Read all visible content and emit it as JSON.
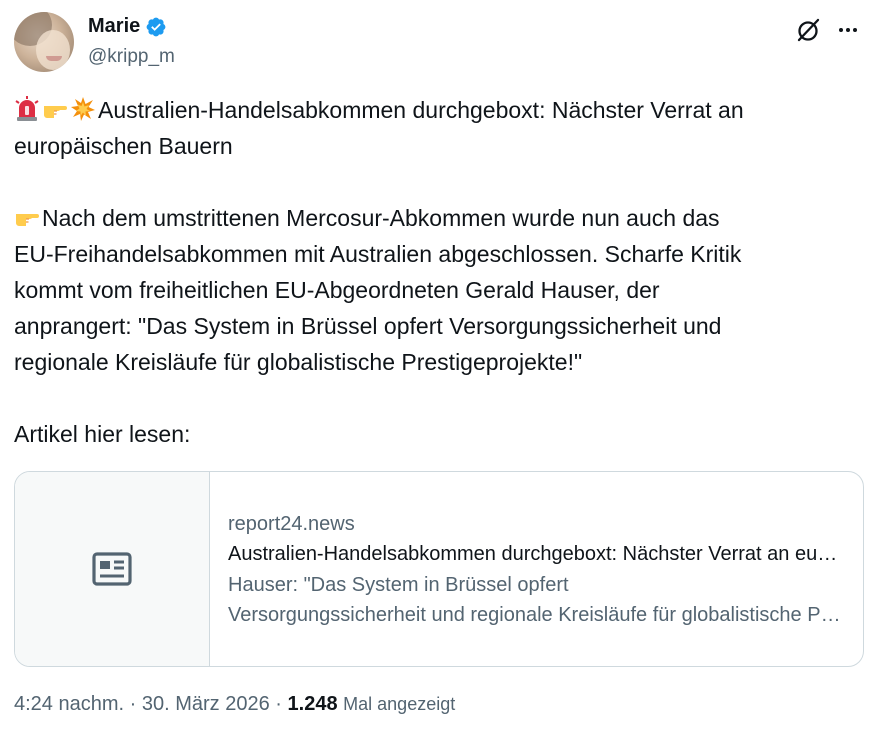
{
  "author": {
    "display_name": "Marie",
    "handle": "@kripp_m",
    "verified_icon": "verified-badge-icon",
    "verified_color": "#1d9bf0"
  },
  "actions": {
    "grok_icon": "grok-icon",
    "more_icon": "more-options-icon"
  },
  "tweet": {
    "line1": "Australien-Handelsabkommen durchgeboxt: Nächster Verrat an",
    "line2": "europäischen Bauern",
    "line3": "Nach dem umstrittenen Mercosur-Abkommen wurde nun auch das",
    "line4": "EU-Freihandelsabkommen mit Australien abgeschlossen. Scharfe Kritik",
    "line5": "kommt vom freiheitlichen EU-Abgeordneten Gerald Hauser, der",
    "line6": "anprangert: \"Das System in Brüssel opfert Versorgungssicherheit und",
    "line7": "regionale Kreisläufe für globalistische Prestigeprojekte!\"",
    "line8": "Artikel hier lesen:",
    "emojis": [
      "siren-emoji",
      "pointing-hand-emoji",
      "collision-emoji"
    ]
  },
  "card": {
    "icon": "article-icon",
    "domain": "report24.news",
    "title": "Australien-Handelsabkommen durchgeboxt: Nächster Verrat an europäischen Bauern",
    "desc_line1": "Hauser: \"Das System in Brüssel opfert",
    "desc_line2": "Versorgungssicherheit und regionale Kreisläufe für globalistische Prestigeprojekte!\""
  },
  "meta": {
    "time": "4:24 nachm.",
    "sep1": "·",
    "date": "30. März 2026",
    "sep2": "·",
    "views": "1.248",
    "views_label": "Mal angezeigt"
  }
}
